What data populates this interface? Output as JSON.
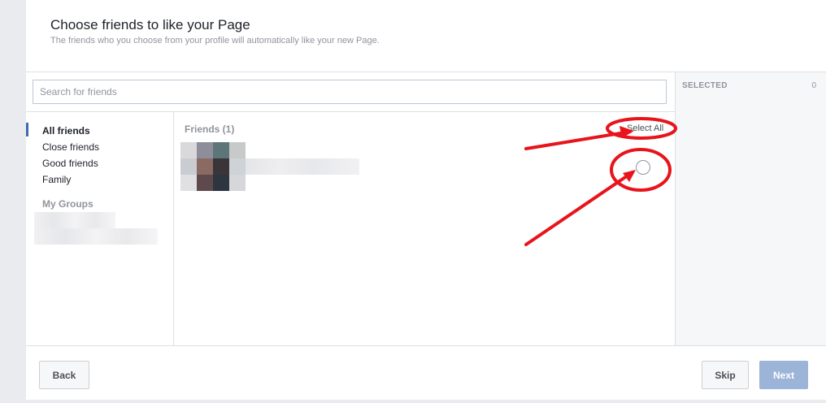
{
  "header": {
    "title": "Choose friends to like your Page",
    "subtitle": "The friends who you choose from your profile will automatically like your new Page."
  },
  "search": {
    "placeholder": "Search for friends",
    "value": ""
  },
  "sidebar": {
    "items": [
      {
        "label": "All friends",
        "active": true
      },
      {
        "label": "Close friends",
        "active": false
      },
      {
        "label": "Good friends",
        "active": false
      },
      {
        "label": "Family",
        "active": false
      }
    ],
    "groups_heading": "My Groups"
  },
  "friends": {
    "heading": "Friends (1)",
    "select_all_label": "Select All"
  },
  "selected": {
    "label": "SELECTED",
    "count": "0"
  },
  "footer": {
    "back_label": "Back",
    "skip_label": "Skip",
    "next_label": "Next"
  },
  "colors": {
    "accent": "#4267b2",
    "next_disabled": "#9cb4d8",
    "annotation": "#e8141b"
  }
}
